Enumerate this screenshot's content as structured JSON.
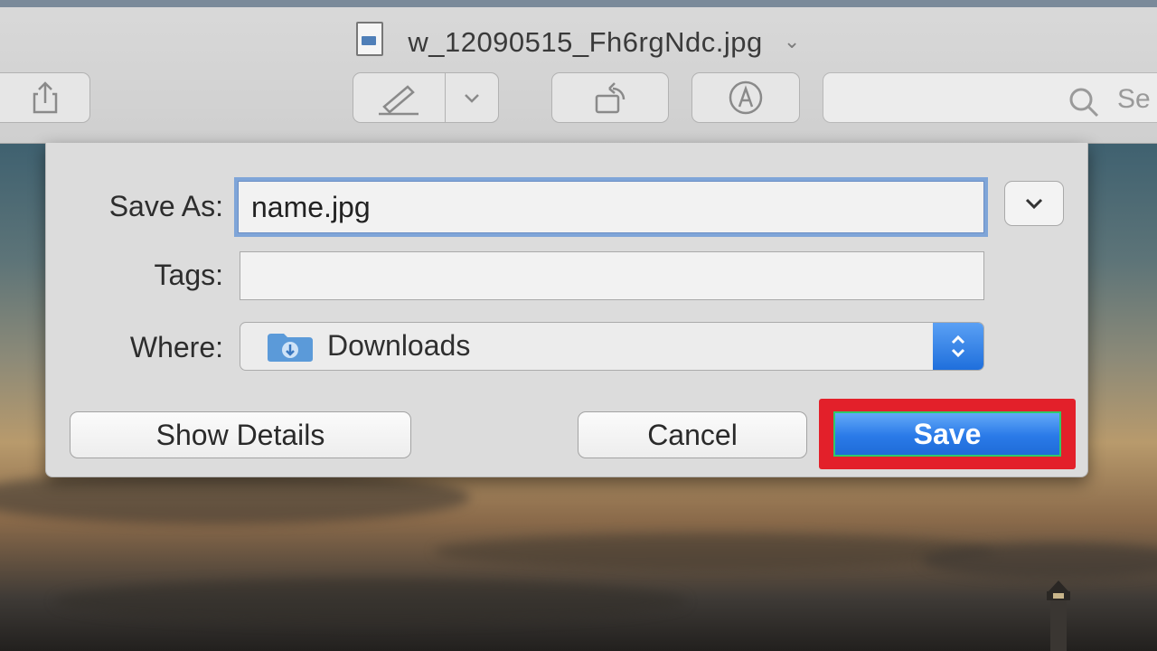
{
  "window": {
    "title": "w_12090515_Fh6rgNdc.jpg",
    "search_placeholder": "Se"
  },
  "dialog": {
    "save_as_label": "Save As:",
    "save_as_value": "name.jpg",
    "tags_label": "Tags:",
    "tags_value": "",
    "where_label": "Where:",
    "where_value": "Downloads",
    "show_details_label": "Show Details",
    "cancel_label": "Cancel",
    "save_label": "Save"
  },
  "colors": {
    "accent_blue": "#2a7ae8",
    "highlight_red": "#e3202a",
    "focus_ring": "#7fa5d8"
  },
  "icons": [
    "document-icon",
    "share-icon",
    "markup-pen-icon",
    "chevron-down-icon",
    "rotate-icon",
    "annotate-icon",
    "search-icon",
    "folder-download-icon",
    "stepper-icon"
  ]
}
